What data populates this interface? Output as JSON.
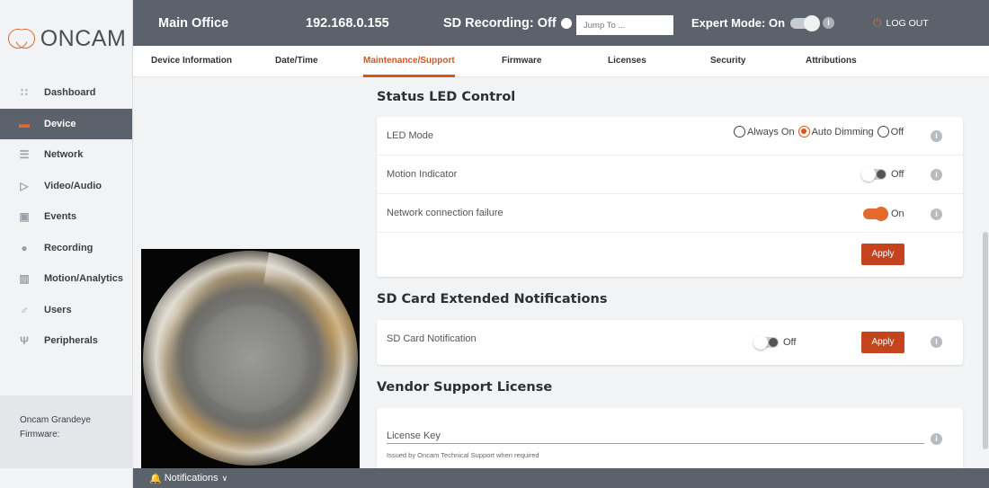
{
  "brand": {
    "name": "ONCAM",
    "accent": "#d9541c"
  },
  "sidebar": {
    "items": [
      {
        "label": "Dashboard",
        "icon": "grid-icon",
        "active": false
      },
      {
        "label": "Device",
        "icon": "camera-icon",
        "active": true
      },
      {
        "label": "Network",
        "icon": "server-icon",
        "active": false
      },
      {
        "label": "Video/Audio",
        "icon": "play-icon",
        "active": false
      },
      {
        "label": "Events",
        "icon": "calendar-icon",
        "active": false
      },
      {
        "label": "Recording",
        "icon": "record-icon",
        "active": false
      },
      {
        "label": "Motion/Analytics",
        "icon": "chart-icon",
        "active": false
      },
      {
        "label": "Users",
        "icon": "user-icon",
        "active": false
      },
      {
        "label": "Peripherals",
        "icon": "usb-icon",
        "active": false
      }
    ],
    "footer": {
      "model": "Oncam Grandeye",
      "firmware_label": "Firmware:"
    }
  },
  "topbar": {
    "site": "Main Office",
    "ip": "192.168.0.155",
    "sd_recording": "SD Recording: Off",
    "jump_placeholder": "Jump To ...",
    "expert_mode": "Expert Mode: On",
    "logout": "LOG OUT"
  },
  "tabs": [
    {
      "label": "Device Information",
      "active": false
    },
    {
      "label": "Date/Time",
      "active": false
    },
    {
      "label": "Maintenance/Support",
      "active": true
    },
    {
      "label": "Firmware",
      "active": false
    },
    {
      "label": "Licenses",
      "active": false
    },
    {
      "label": "Security",
      "active": false
    },
    {
      "label": "Attributions",
      "active": false
    }
  ],
  "led": {
    "title": "Status LED Control",
    "mode_label": "LED Mode",
    "options": [
      "Always On",
      "Auto Dimming",
      "Off"
    ],
    "selected": "Auto Dimming",
    "motion_label": "Motion Indicator",
    "motion_state": "Off",
    "network_label": "Network connection failure",
    "network_state": "On",
    "apply": "Apply"
  },
  "sd": {
    "title": "SD Card Extended Notifications",
    "label": "SD Card Notification",
    "state": "Off",
    "apply": "Apply"
  },
  "vendor": {
    "title": "Vendor Support License",
    "label": "License Key",
    "help": "Issued by Oncam Technical Support when required"
  },
  "notifications": {
    "label": "Notifications"
  }
}
